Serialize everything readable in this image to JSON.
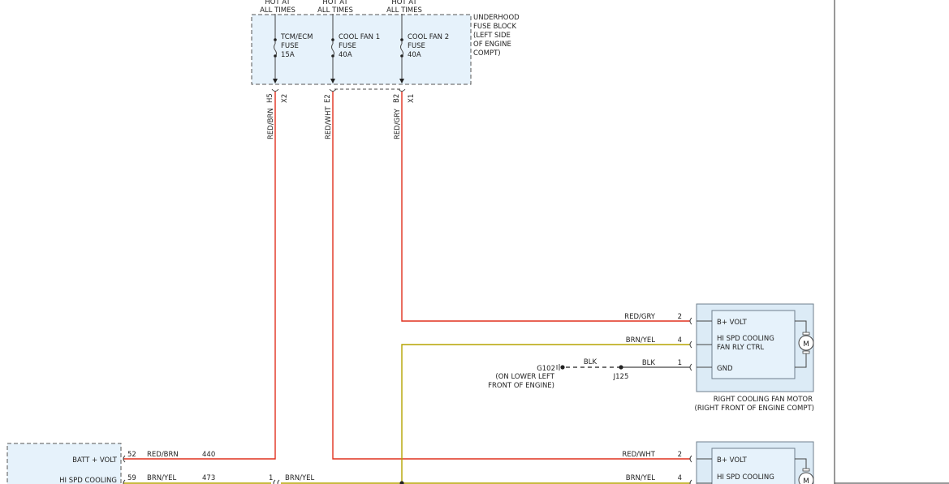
{
  "fuse_block": {
    "hot_labels": [
      {
        "line1": "HOT AT",
        "line2": "ALL TIMES"
      },
      {
        "line1": "HOT AT",
        "line2": "ALL TIMES"
      },
      {
        "line1": "HOT AT",
        "line2": "ALL TIMES"
      }
    ],
    "name_lines": [
      "UNDERHOOD",
      "FUSE BLOCK",
      "(LEFT SIDE",
      "OF ENGINE",
      "COMPT)"
    ],
    "fuses": [
      {
        "name1": "TCM/ECM",
        "name2": "FUSE",
        "rating": "15A"
      },
      {
        "name1": "COOL FAN 1",
        "name2": "FUSE",
        "rating": "40A"
      },
      {
        "name1": "COOL FAN 2",
        "name2": "FUSE",
        "rating": "40A"
      }
    ],
    "pins": [
      {
        "pin": "H5",
        "conn": "X2"
      },
      {
        "pin": "E2",
        "conn": ""
      },
      {
        "pin": "B2",
        "conn": "X1"
      }
    ]
  },
  "vertical_wires": [
    {
      "color": "RED/BRN"
    },
    {
      "color": "RED/WHT"
    },
    {
      "color": "RED/GRY"
    }
  ],
  "right_motor": {
    "terminals": [
      {
        "pin": "2",
        "label": "B+ VOLT",
        "wire": "RED/GRY"
      },
      {
        "pin": "4",
        "label1": "HI SPD COOLING",
        "label2": "FAN RLY CTRL",
        "wire": "BRN/YEL"
      },
      {
        "pin": "1",
        "label": "GND",
        "wire": "BLK"
      }
    ],
    "motor_symbol": "M",
    "caption1": "RIGHT COOLING FAN MOTOR",
    "caption2": "(RIGHT FRONT OF ENGINE COMPT)"
  },
  "ground": {
    "splice": "J125",
    "wire": "BLK",
    "id": "G102",
    "loc1": "(ON LOWER LEFT",
    "loc2": "FRONT OF ENGINE)"
  },
  "left_module": {
    "rows": [
      {
        "label": "BATT + VOLT",
        "pin": "52",
        "wire": "RED/BRN",
        "circuit": "440"
      },
      {
        "label": "HI SPD COOLING",
        "pin": "59",
        "wire": "BRN/YEL",
        "circuit": "473"
      }
    ],
    "inline_pin": "1",
    "inline_wire": "BRN/YEL"
  },
  "bottom_motor": {
    "terminals": [
      {
        "pin": "2",
        "label": "B+ VOLT",
        "wire": "RED/WHT"
      },
      {
        "pin": "4",
        "label1": "HI SPD COOLING",
        "wire": "BRN/YEL"
      }
    ]
  }
}
